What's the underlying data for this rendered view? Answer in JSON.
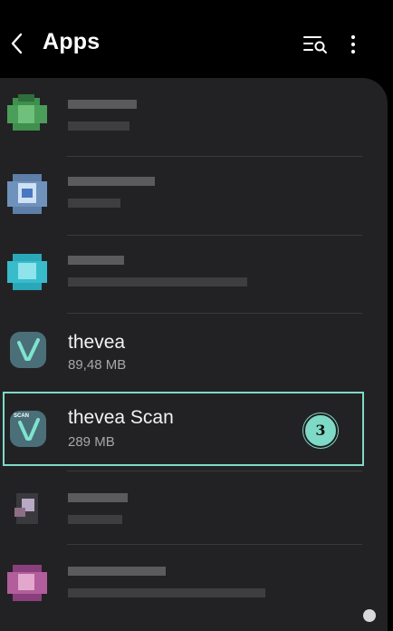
{
  "header": {
    "title": "Apps",
    "back_icon": "chevron-left-icon",
    "search_icon": "list-search-icon",
    "more_icon": "more-vertical-icon"
  },
  "apps": [
    {
      "name": "",
      "size": "",
      "blurred": true
    },
    {
      "name": "",
      "size": "",
      "blurred": true
    },
    {
      "name": "",
      "size": "",
      "blurred": true
    },
    {
      "name": "thevea",
      "size": "89,48 MB",
      "icon": "thevea-icon"
    },
    {
      "name": "thevea Scan",
      "size": "289 MB",
      "icon": "thevea-scan-icon",
      "icon_label": "SCAN"
    },
    {
      "name": "",
      "size": "",
      "blurred": true
    },
    {
      "name": "",
      "size": "",
      "blurred": true
    }
  ],
  "annotation": {
    "badge_label": "3",
    "color": "#7fd9c7"
  }
}
